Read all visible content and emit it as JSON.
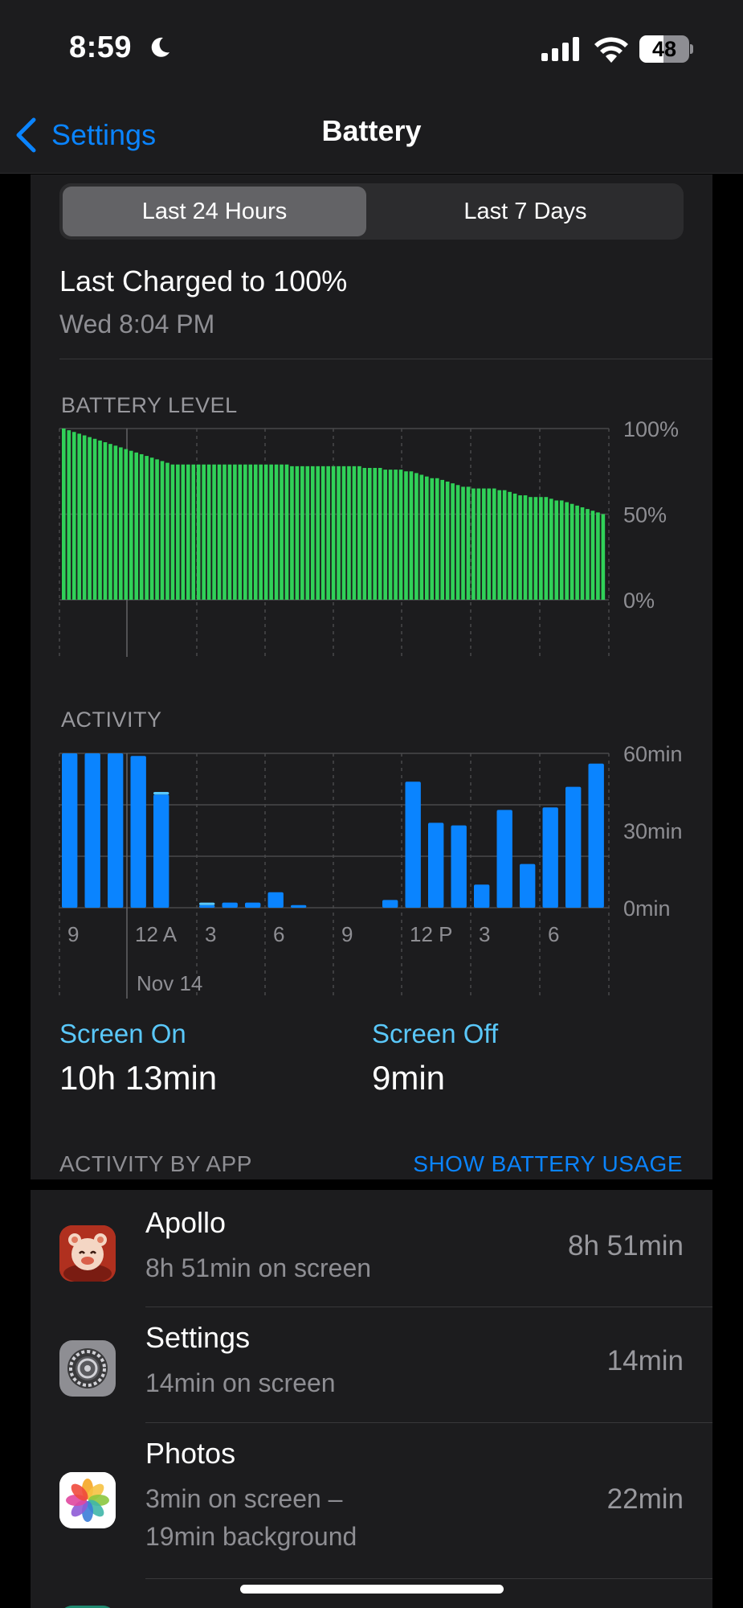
{
  "status": {
    "time": "8:59",
    "battery_level": "48",
    "battery_fraction": 0.48
  },
  "nav": {
    "back_label": "Settings",
    "title": "Battery"
  },
  "segments": {
    "active": "Last 24 Hours",
    "inactive": "Last 7 Days"
  },
  "last_charged": {
    "title": "Last Charged to 100%",
    "time": "Wed 8:04 PM"
  },
  "chart_data": [
    {
      "type": "bar",
      "title": "BATTERY LEVEL",
      "ylim": [
        0,
        100
      ],
      "ytick_labels": [
        "100%",
        "50%",
        "0%"
      ],
      "xtick_labels": [
        "9",
        "12 A",
        "3",
        "6",
        "9",
        "12 P",
        "3",
        "6"
      ],
      "values": [
        100,
        99,
        98,
        97,
        96,
        95,
        94,
        93,
        92,
        91,
        90,
        89,
        88,
        87,
        86,
        85,
        84,
        83,
        82,
        81,
        80,
        79,
        79,
        79,
        79,
        79,
        79,
        79,
        79,
        79,
        79,
        79,
        79,
        79,
        79,
        79,
        79,
        79,
        79,
        79,
        79,
        79,
        79,
        79,
        78,
        78,
        78,
        78,
        78,
        78,
        78,
        78,
        78,
        78,
        78,
        78,
        78,
        78,
        77,
        77,
        77,
        77,
        76,
        76,
        76,
        76,
        75,
        75,
        74,
        73,
        72,
        71,
        71,
        70,
        69,
        68,
        67,
        66,
        66,
        65,
        65,
        65,
        65,
        65,
        64,
        64,
        63,
        62,
        61,
        61,
        60,
        60,
        60,
        60,
        59,
        58,
        58,
        57,
        56,
        55,
        54,
        53,
        52,
        51,
        50
      ]
    },
    {
      "type": "bar",
      "title": "ACTIVITY",
      "ylim": [
        0,
        60
      ],
      "ytick_labels": [
        "60min",
        "30min",
        "0min"
      ],
      "xtick_labels": [
        "9",
        "12 A",
        "3",
        "6",
        "9",
        "12 P",
        "3",
        "6"
      ],
      "date_label": "Nov 14",
      "series": [
        {
          "color": "#0a84ff",
          "values": [
            60,
            60,
            60,
            59,
            44,
            0,
            1,
            2,
            2,
            6,
            1,
            0,
            0,
            0,
            3,
            49,
            33,
            32,
            9,
            38,
            17,
            39,
            47,
            56
          ]
        },
        {
          "color": "#5ac8fa",
          "values": [
            0,
            0,
            0,
            0,
            1,
            0,
            1,
            0,
            0,
            0,
            0,
            0,
            0,
            0,
            0,
            0,
            0,
            0,
            0,
            0,
            0,
            0,
            0,
            0
          ]
        }
      ]
    }
  ],
  "usage": {
    "screen_on_label": "Screen On",
    "screen_on_value": "10h 13min",
    "screen_off_label": "Screen Off",
    "screen_off_value": "9min"
  },
  "activity_by_app": {
    "title": "ACTIVITY BY APP",
    "link": "SHOW BATTERY USAGE",
    "apps": [
      {
        "name": "Apollo",
        "detail1": "8h 51min on screen",
        "detail2": "",
        "time": "8h 51min",
        "icon": "apollo-icon"
      },
      {
        "name": "Settings",
        "detail1": "14min on screen",
        "detail2": "",
        "time": "14min",
        "icon": "settings-gear-icon"
      },
      {
        "name": "Photos",
        "detail1": "3min on screen –",
        "detail2": "19min background",
        "time": "22min",
        "icon": "photos-icon"
      }
    ]
  }
}
